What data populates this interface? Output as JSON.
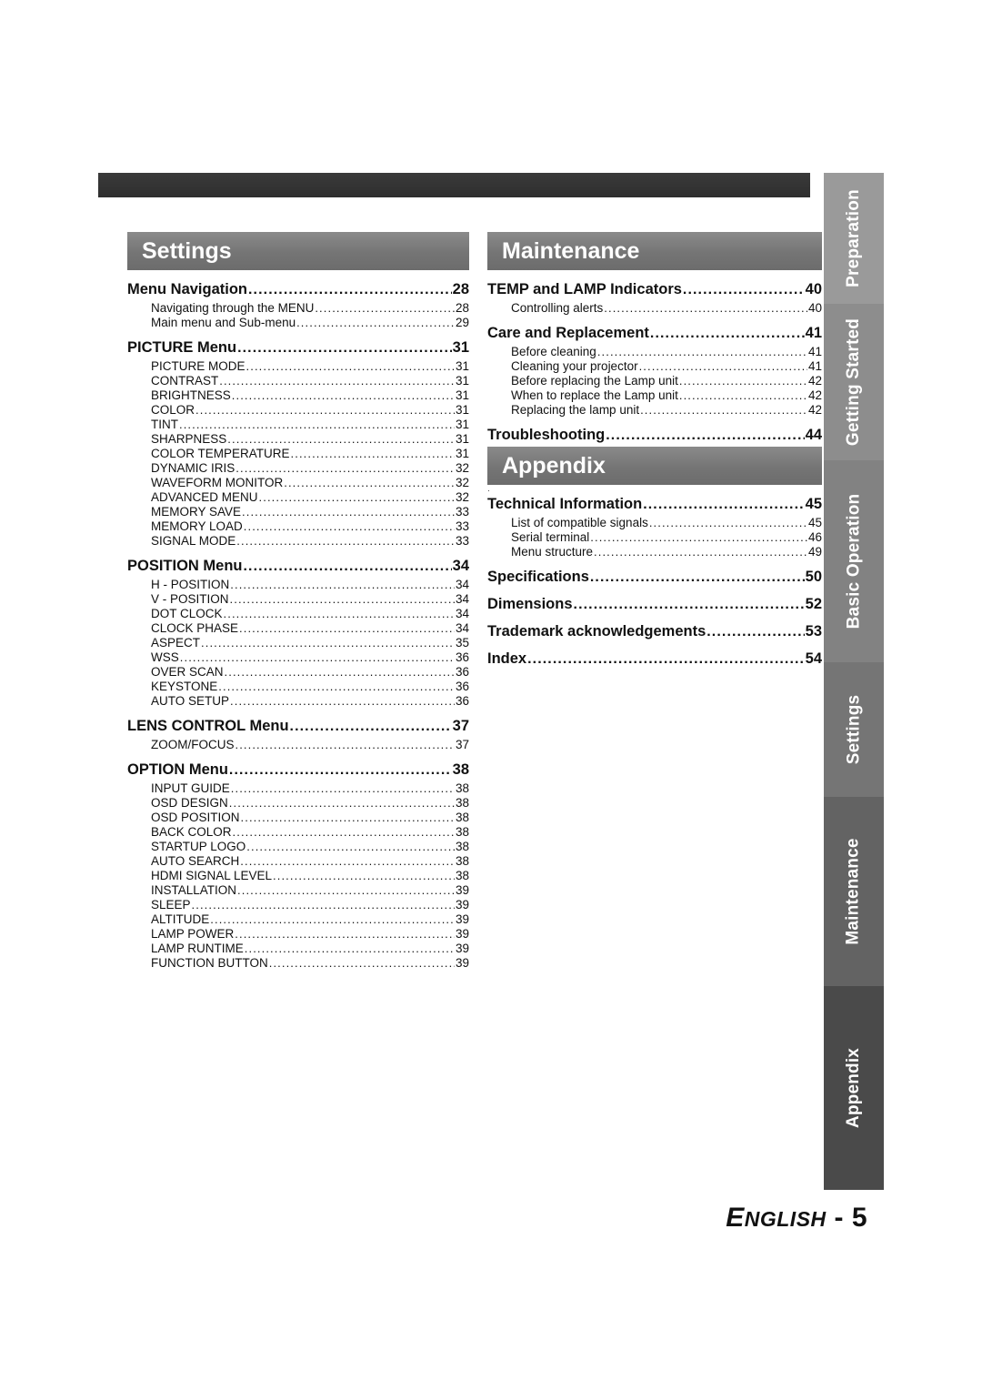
{
  "page": {
    "footer_language": "ENGLISH",
    "footer_separator": "-",
    "footer_page_number": "5"
  },
  "side_tabs": [
    {
      "label": "Preparation"
    },
    {
      "label": "Getting Started"
    },
    {
      "label": "Basic Operation"
    },
    {
      "label": "Settings"
    },
    {
      "label": "Maintenance"
    },
    {
      "label": "Appendix"
    }
  ],
  "sections": [
    {
      "title": "Settings",
      "column": "left",
      "entries": [
        {
          "level": 1,
          "text": "Menu Navigation",
          "page": "28"
        },
        {
          "level": 2,
          "text": "Navigating through the MENU",
          "page": "28"
        },
        {
          "level": 2,
          "text": "Main menu and Sub-menu",
          "page": "29"
        },
        {
          "level": 1,
          "text": "PICTURE Menu",
          "page": "31"
        },
        {
          "level": 2,
          "text": "PICTURE MODE",
          "page": "31"
        },
        {
          "level": 2,
          "text": "CONTRAST",
          "page": "31"
        },
        {
          "level": 2,
          "text": "BRIGHTNESS",
          "page": "31"
        },
        {
          "level": 2,
          "text": "COLOR",
          "page": "31"
        },
        {
          "level": 2,
          "text": "TINT",
          "page": "31"
        },
        {
          "level": 2,
          "text": "SHARPNESS",
          "page": "31"
        },
        {
          "level": 2,
          "text": "COLOR TEMPERATURE",
          "page": "31"
        },
        {
          "level": 2,
          "text": "DYNAMIC IRIS",
          "page": "32"
        },
        {
          "level": 2,
          "text": "WAVEFORM MONITOR",
          "page": "32"
        },
        {
          "level": 2,
          "text": "ADVANCED MENU",
          "page": "32"
        },
        {
          "level": 2,
          "text": "MEMORY SAVE",
          "page": "33"
        },
        {
          "level": 2,
          "text": "MEMORY LOAD",
          "page": "33"
        },
        {
          "level": 2,
          "text": "SIGNAL MODE",
          "page": "33"
        },
        {
          "level": 1,
          "text": "POSITION Menu",
          "page": "34"
        },
        {
          "level": 2,
          "text": "H - POSITION",
          "page": "34"
        },
        {
          "level": 2,
          "text": "V - POSITION",
          "page": "34"
        },
        {
          "level": 2,
          "text": "DOT CLOCK",
          "page": "34"
        },
        {
          "level": 2,
          "text": "CLOCK PHASE",
          "page": "34"
        },
        {
          "level": 2,
          "text": "ASPECT",
          "page": "35"
        },
        {
          "level": 2,
          "text": "WSS",
          "page": "36"
        },
        {
          "level": 2,
          "text": "OVER SCAN",
          "page": "36"
        },
        {
          "level": 2,
          "text": "KEYSTONE",
          "page": "36"
        },
        {
          "level": 2,
          "text": "AUTO SETUP",
          "page": "36"
        },
        {
          "level": 1,
          "text": "LENS CONTROL Menu",
          "page": "37"
        },
        {
          "level": 2,
          "text": "ZOOM/FOCUS",
          "page": "37"
        },
        {
          "level": 1,
          "text": "OPTION Menu",
          "page": "38"
        },
        {
          "level": 2,
          "text": "INPUT GUIDE",
          "page": "38"
        },
        {
          "level": 2,
          "text": "OSD DESIGN",
          "page": "38"
        },
        {
          "level": 2,
          "text": "OSD POSITION",
          "page": "38"
        },
        {
          "level": 2,
          "text": "BACK COLOR",
          "page": "38"
        },
        {
          "level": 2,
          "text": "STARTUP LOGO",
          "page": "38"
        },
        {
          "level": 2,
          "text": "AUTO SEARCH",
          "page": "38"
        },
        {
          "level": 2,
          "text": "HDMI SIGNAL LEVEL",
          "page": "38"
        },
        {
          "level": 2,
          "text": "INSTALLATION",
          "page": "39"
        },
        {
          "level": 2,
          "text": "SLEEP",
          "page": "39"
        },
        {
          "level": 2,
          "text": "ALTITUDE",
          "page": "39"
        },
        {
          "level": 2,
          "text": "LAMP POWER",
          "page": "39"
        },
        {
          "level": 2,
          "text": "LAMP RUNTIME",
          "page": "39"
        },
        {
          "level": 2,
          "text": "FUNCTION BUTTON",
          "page": "39"
        }
      ]
    },
    {
      "title": "Maintenance",
      "column": "right",
      "entries": [
        {
          "level": 1,
          "text": "TEMP and LAMP Indicators",
          "page": "40"
        },
        {
          "level": 2,
          "text": "Controlling alerts",
          "page": "40"
        },
        {
          "level": 1,
          "text": "Care and Replacement",
          "page": "41"
        },
        {
          "level": 2,
          "text": "Before cleaning",
          "page": "41"
        },
        {
          "level": 2,
          "text": "Cleaning your projector",
          "page": "41"
        },
        {
          "level": 2,
          "text": "Before replacing the Lamp unit",
          "page": "42"
        },
        {
          "level": 2,
          "text": "When to replace the Lamp unit",
          "page": "42"
        },
        {
          "level": 2,
          "text": "Replacing the lamp unit",
          "page": "42"
        },
        {
          "level": 1,
          "text": "Troubleshooting",
          "page": "44"
        }
      ]
    },
    {
      "title": "Appendix",
      "column": "right",
      "entries": [
        {
          "level": 1,
          "text": "Technical Information",
          "page": "45"
        },
        {
          "level": 2,
          "text": "List of compatible signals",
          "page": "45"
        },
        {
          "level": 2,
          "text": "Serial terminal",
          "page": "46"
        },
        {
          "level": 2,
          "text": "Menu structure",
          "page": "49"
        },
        {
          "level": 1,
          "text": "Specifications",
          "page": "50"
        },
        {
          "level": 1,
          "text": "Dimensions",
          "page": "52"
        },
        {
          "level": 1,
          "text": "Trademark acknowledgements",
          "page": "53"
        },
        {
          "level": 1,
          "text": "Index",
          "page": "54"
        }
      ]
    }
  ]
}
